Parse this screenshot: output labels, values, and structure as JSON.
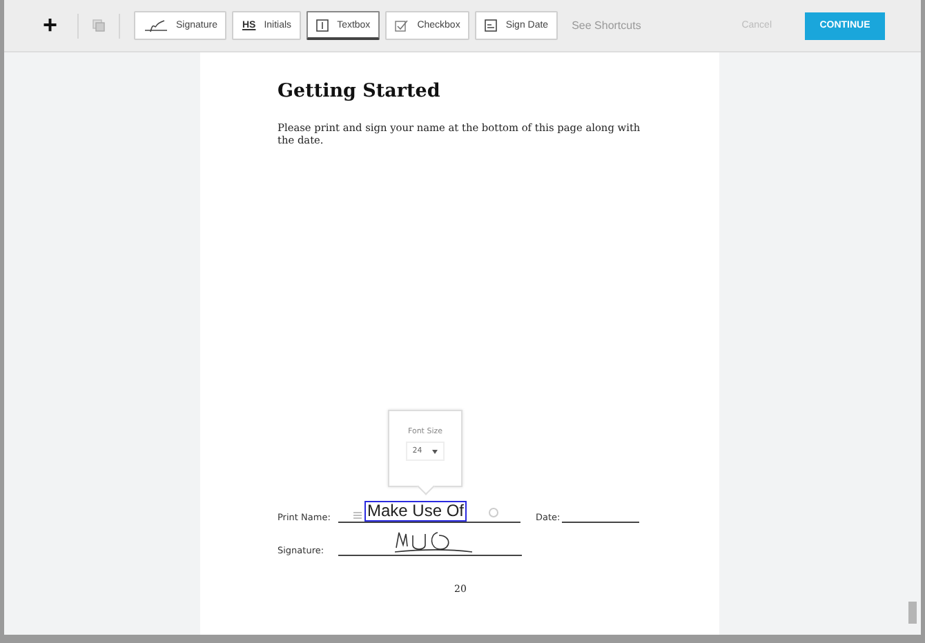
{
  "toolbar": {
    "add_label": "+",
    "tools": [
      {
        "kind": "signature",
        "label": "Signature",
        "selected": false
      },
      {
        "kind": "initials",
        "label": "Initials",
        "icon_text": "HS",
        "selected": false
      },
      {
        "kind": "textbox",
        "label": "Textbox",
        "selected": true
      },
      {
        "kind": "checkbox",
        "label": "Checkbox",
        "selected": false
      },
      {
        "kind": "date",
        "label": "Sign Date",
        "selected": false
      }
    ],
    "shortcuts_link": "See Shortcuts",
    "cancel": "Cancel",
    "continue": "CONTINUE"
  },
  "document": {
    "title": "Getting Started",
    "body": "Please print and sign your name at the bottom of this page along with the date.",
    "font_popover": {
      "label": "Font Size",
      "value": "24"
    },
    "print_name_label": "Print Name:",
    "print_name_value": "Make Use Of",
    "date_label": "Date:",
    "signature_label": "Signature:",
    "page_number": "20"
  }
}
